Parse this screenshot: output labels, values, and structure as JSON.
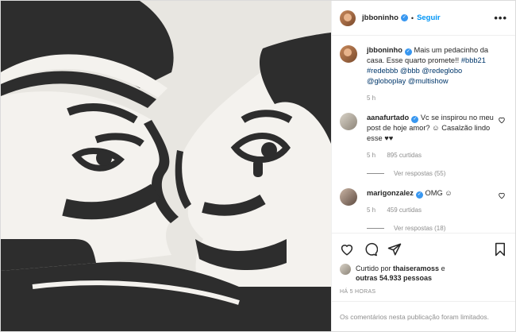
{
  "post": {
    "author": "jbboninho",
    "follow_label": "Seguir",
    "separator": "•",
    "more_label": "•••"
  },
  "caption": {
    "author": "jbboninho",
    "text_part1": "Mais um pedacinho da casa. Esse quarto promete!! ",
    "hashtags": "#bbb21 #redebbb @bbb @redeglobo @globoplay @multishow",
    "time": "5 h"
  },
  "comments": [
    {
      "author": "aanafurtado",
      "text": "Vc se inspirou no meu post de hoje amor? ☺ Casalzão lindo esse ♥♥",
      "time": "5 h",
      "likes": "895 curtidas",
      "replies": "Ver respostas (55)"
    },
    {
      "author": "marigonzalez",
      "text": "OMG ☺",
      "time": "5 h",
      "likes": "459 curtidas",
      "replies": "Ver respostas (18)"
    }
  ],
  "likes": {
    "prefix": "Curtido por ",
    "user": "thaiseramoss",
    "middle": " e",
    "others": "outras 54.933 pessoas"
  },
  "timestamp": "HÁ 5 HORAS",
  "limited_notice": "Os comentários nesta publicação foram limitados.",
  "colors": {
    "accent": "#0095f6",
    "verified": "#3897f0",
    "muted": "#8e8e8e"
  },
  "icons": [
    "heart-icon",
    "comment-icon",
    "share-icon",
    "bookmark-icon",
    "verified-icon",
    "more-icon"
  ]
}
